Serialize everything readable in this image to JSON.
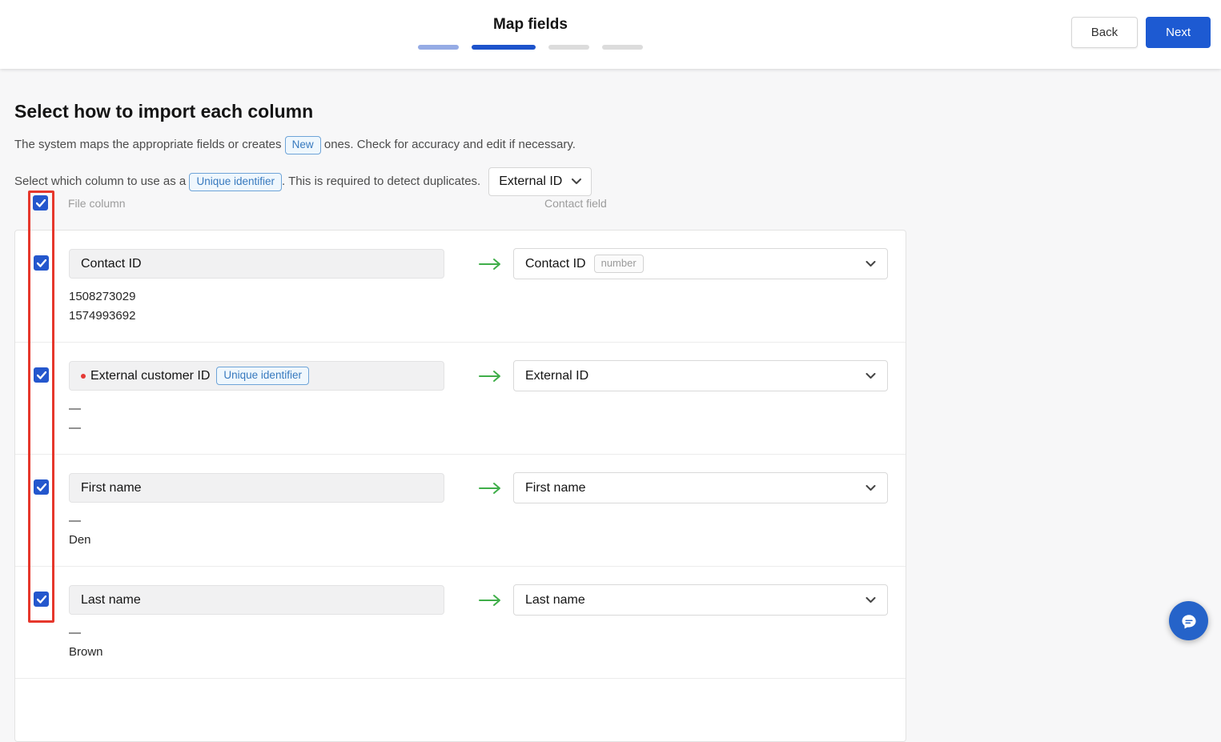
{
  "header": {
    "title": "Map fields",
    "back_button": "Back",
    "next_button": "Next",
    "progress_steps": [
      "complete",
      "current",
      "pending",
      "pending"
    ]
  },
  "intro": {
    "heading": "Select how to import each column",
    "line1_before_badge": "The system maps the appropriate fields or creates",
    "new_badge": "New",
    "line1_after_badge": "ones. Check for accuracy and edit if necessary.",
    "line2_before_badge": "Select which column to use as a",
    "unique_identifier_badge": "Unique identifier",
    "line2_after_badge": ". This is required to detect duplicates.",
    "unique_identifier_value": "External ID"
  },
  "table": {
    "file_column_header": "File column",
    "contact_field_header": "Contact field",
    "select_all_checked": true,
    "rows": [
      {
        "checked": true,
        "file_column": "Contact ID",
        "contact_field": "Contact ID",
        "field_type_badge": "number",
        "samples": [
          "1508273029",
          "1574993692"
        ]
      },
      {
        "checked": true,
        "file_column": "External customer ID",
        "unique_identifier_badge": "Unique identifier",
        "contact_field": "External ID",
        "samples": [
          "—",
          "—"
        ]
      },
      {
        "checked": true,
        "file_column": "First name",
        "contact_field": "First name",
        "samples": [
          "—",
          "Den"
        ]
      },
      {
        "checked": true,
        "file_column": "Last name",
        "contact_field": "Last name",
        "samples": [
          "—",
          "Brown"
        ]
      }
    ]
  },
  "colors": {
    "accent_blue": "#1d5ad2",
    "checkbox_blue": "#2457cd",
    "badge_blue": "#3779be",
    "arrow_green": "#3fae49",
    "annotation_red": "#e6372c"
  }
}
